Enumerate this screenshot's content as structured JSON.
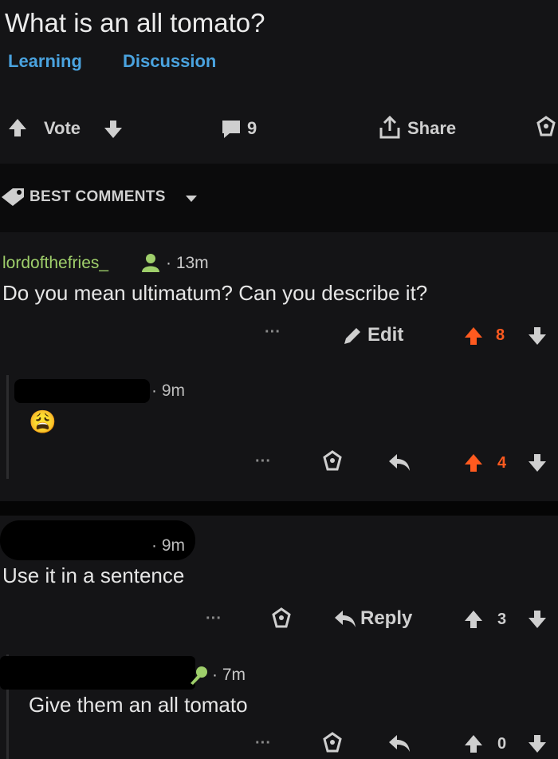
{
  "post": {
    "title": "What is an all tomato?",
    "flairs": [
      "Learning",
      "Discussion"
    ],
    "vote_label": "Vote",
    "comment_count": "9",
    "share_label": "Share"
  },
  "sort": {
    "label": "BEST COMMENTS"
  },
  "comments": [
    {
      "author": "lordofthefries_",
      "time": "13m",
      "body": "Do you mean ultimatum? Can you describe it?",
      "more": "···",
      "edit_label": "Edit",
      "score": "8"
    },
    {
      "time": "9m",
      "body": "😩",
      "more": "···",
      "score": "4"
    },
    {
      "time": "9m",
      "body": "Use it in a sentence",
      "more": "···",
      "reply_label": "Reply",
      "score": "3"
    },
    {
      "time": "7m",
      "body": "Give them an all tomato",
      "more": "···",
      "score": "0"
    }
  ],
  "colors": {
    "background": "#141416",
    "accent_blue": "#4aa3df",
    "upvote_orange": "#ff5a1f",
    "username_green": "#9fcf6b"
  },
  "icons": [
    "upvote-icon",
    "downvote-icon",
    "comment-icon",
    "share-icon",
    "award-icon",
    "sort-icon",
    "person-icon",
    "pencil-icon",
    "reply-icon"
  ]
}
